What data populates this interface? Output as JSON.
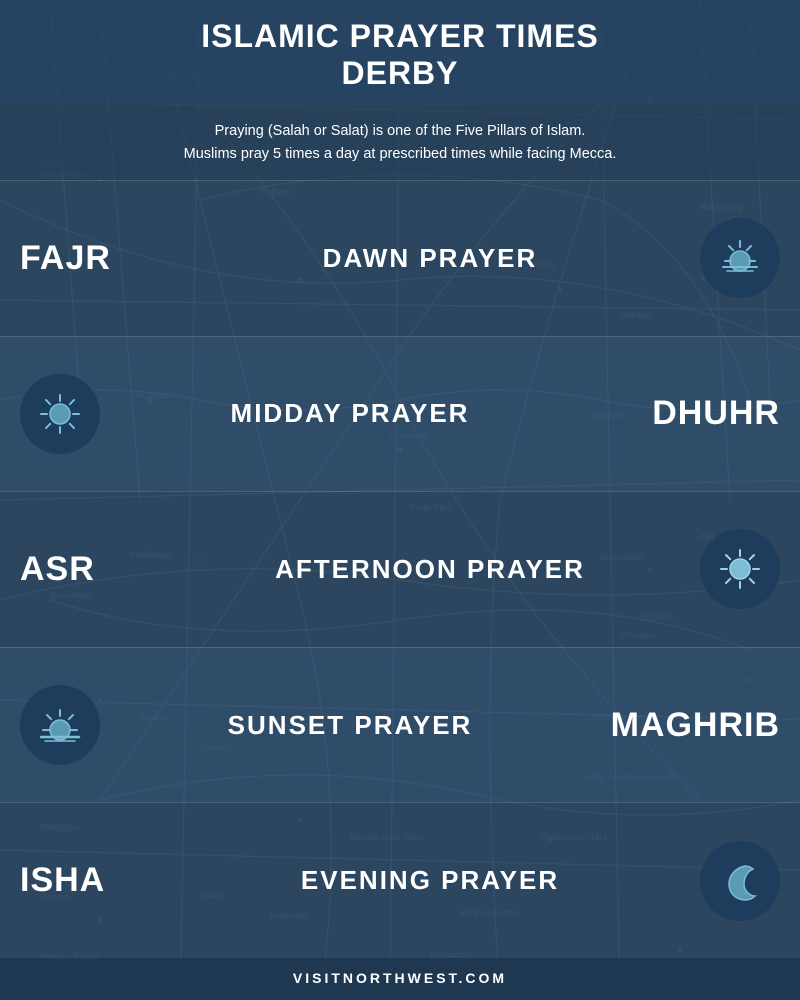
{
  "page": {
    "title_line1": "ISLAMIC PRAYER TIMES",
    "title_line2": "DERBY",
    "subtitle": "Praying (Salah or Salat) is one of the Five Pillars of Islam.\nMuslims pray 5 times a day at prescribed times while facing Mecca.",
    "footer": "VISITNORTHWEST.COM"
  },
  "prayers": [
    {
      "id": "fajr",
      "name": "FAJR",
      "label": "DAWN PRAYER",
      "name_position": "left",
      "icon": "dawn"
    },
    {
      "id": "dhuhr",
      "name": "DHUHR",
      "label": "MIDDAY PRAYER",
      "name_position": "right",
      "icon": "sun"
    },
    {
      "id": "asr",
      "name": "ASR",
      "label": "AFTERNOON PRAYER",
      "name_position": "left",
      "icon": "sun-bright"
    },
    {
      "id": "maghrib",
      "name": "MAGHRIB",
      "label": "SUNSET PRAYER",
      "name_position": "right",
      "icon": "sunset"
    },
    {
      "id": "isha",
      "name": "ISHA",
      "label": "EVENING PRAYER",
      "name_position": "left",
      "icon": "moon"
    }
  ]
}
